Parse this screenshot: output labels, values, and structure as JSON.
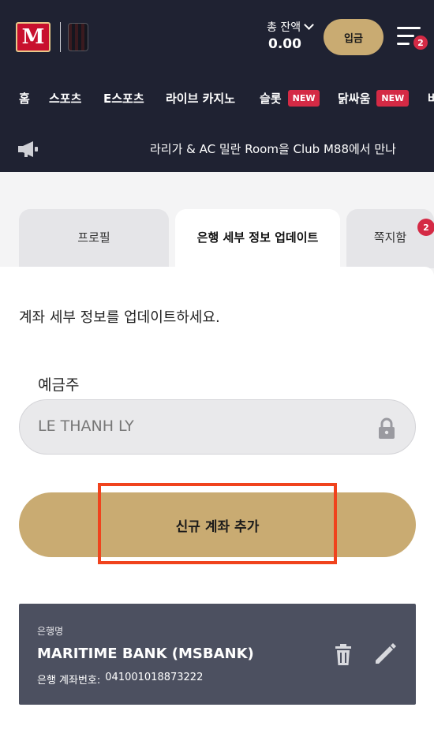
{
  "header": {
    "logo_letter": "M",
    "balance_label": "총 잔액",
    "balance_value": "0.00",
    "deposit_label": "입금",
    "menu_badge": "2"
  },
  "nav": {
    "items": [
      {
        "label": "홈"
      },
      {
        "label": "스포츠"
      },
      {
        "label": "E스포츠"
      },
      {
        "label": "라이브 카지노"
      },
      {
        "label": "슬롯",
        "badge": "NEW"
      },
      {
        "label": "닭싸움",
        "badge": "NEW"
      },
      {
        "label": "바"
      }
    ]
  },
  "announcement": {
    "text": "라리가 & AC 밀란 Room을 Club M88에서 만나"
  },
  "tabs": [
    {
      "label": "프로필",
      "active": false
    },
    {
      "label": "은행 세부 정보 업데이트",
      "active": true
    },
    {
      "label": "쪽지함",
      "active": false,
      "badge": "2"
    }
  ],
  "form": {
    "instruction": "계좌 세부 정보를 업데이트하세요.",
    "holder_label": "예금주",
    "holder_value": "LE THANH LY",
    "add_button_label": "신규 계좌 추가"
  },
  "account_card": {
    "bank_label": "은행명",
    "bank_name": "MARITIME BANK (MSBANK)",
    "account_label": "은행 계좌번호:",
    "account_number": "041001018873222"
  },
  "colors": {
    "header_bg": "#1f2232",
    "gold": "#c9ab72",
    "badge_red": "#d42a45",
    "highlight": "#f0431d",
    "card_bg": "#4c5060"
  }
}
